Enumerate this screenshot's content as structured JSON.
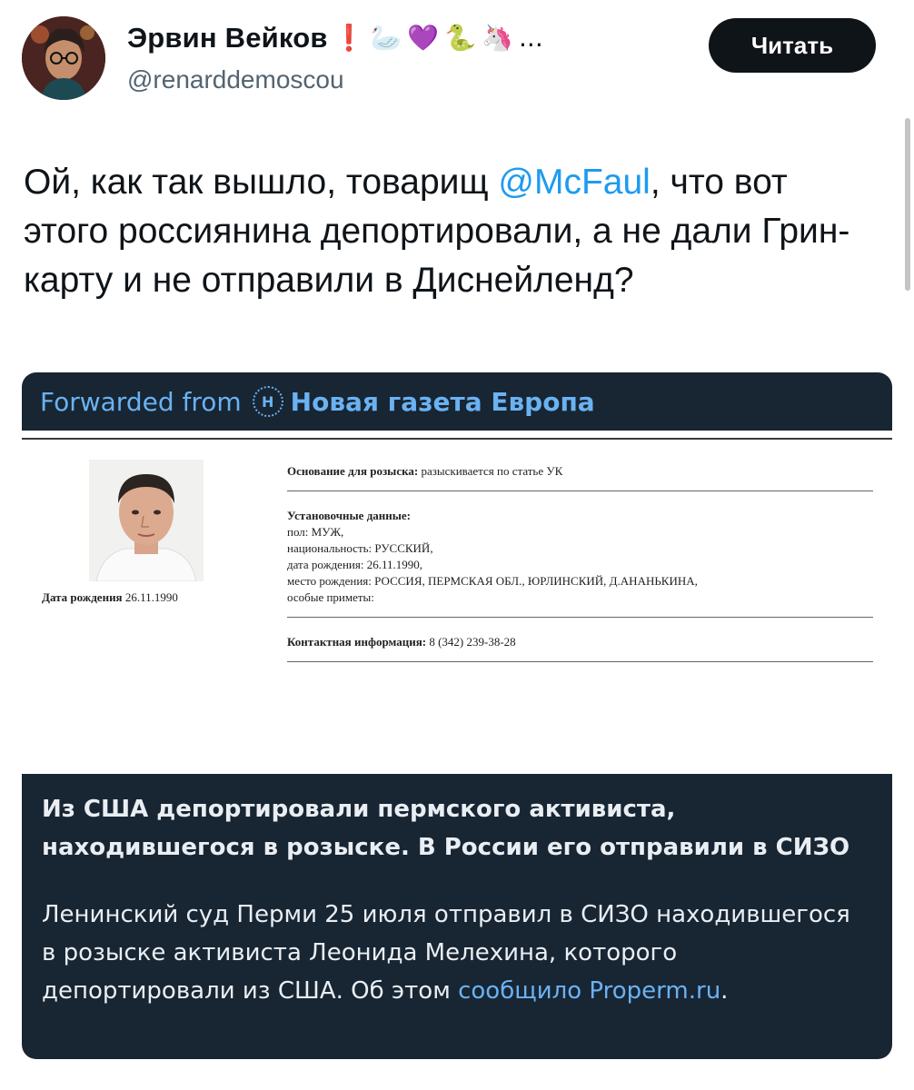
{
  "user": {
    "display_name": "Эрвин Вейков",
    "handle": "@renarddemoscou",
    "emojis": [
      "❗",
      "🦢",
      "💜",
      "🐍",
      "🦄",
      "..."
    ],
    "avatar_icon": "avatar-photo"
  },
  "follow_button_label": "Читать",
  "tweet": {
    "text_before": "Ой, как так вышло, товарищ ",
    "mention": "@McFaul",
    "text_after": ", что вот этого россиянина депортировали, а не дали Грин-карту и не отправили в Диснейленд?"
  },
  "forwarded": {
    "prefix": "Forwarded from",
    "channel_icon_letter": "Н",
    "channel": "Новая газета Европа"
  },
  "document": {
    "dob_label": "Дата рождения",
    "dob_value": "26.11.1990",
    "basis_label": "Основание для розыска:",
    "basis_value": "разыскивается по статье УК",
    "setup_label": "Установочные данные:",
    "gender": "пол: МУЖ,",
    "nationality": "национальность: РУССКИЙ,",
    "birth_date": "дата рождения: 26.11.1990,",
    "birth_place": "место рождения: РОССИЯ, ПЕРМСКАЯ ОБЛ., ЮРЛИНСКИЙ, Д.АНАНЬКИНА,",
    "features": "особые приметы:",
    "contact_label": "Контактная информация:",
    "contact_value": "8 (342) 239-38-28"
  },
  "article": {
    "title": "Из США депортировали пермского активиста, находившегося в розыске. В России его отправили в СИЗО",
    "body_before": "Ленинский суд Перми 25 июля отправил в СИЗО находившегося в розыске активиста Леонида Мелехина, которого депортировали из США. Об этом ",
    "link_text": "сообщило Properm.ru",
    "body_after": "."
  },
  "colors": {
    "card_bg": "#182533",
    "link": "#6ab2f2",
    "mention": "#1d9bf0",
    "button_bg": "#0f1419"
  }
}
